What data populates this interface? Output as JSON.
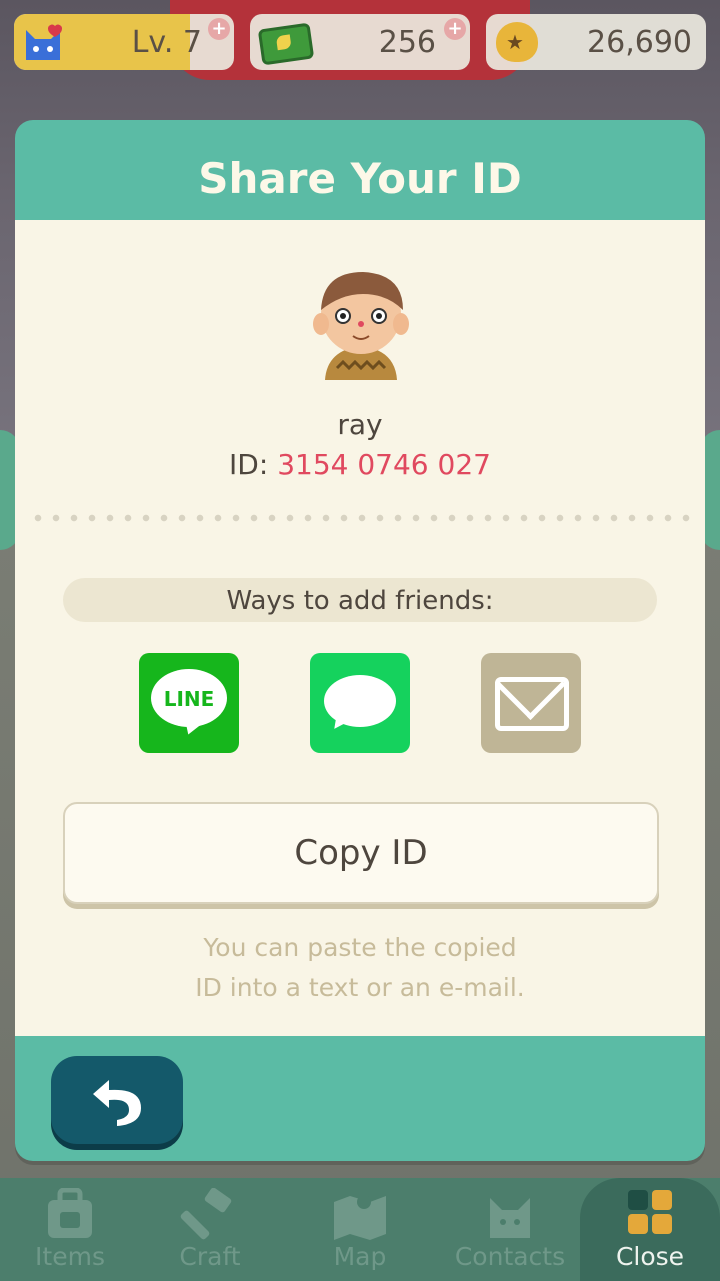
{
  "hud": {
    "level_label": "Lv. 7",
    "level_progress": 0.8,
    "leaf_tickets": "256",
    "bells": "26,690",
    "plus_symbol": "+"
  },
  "dialog": {
    "title": "Share Your ID",
    "player_name": "ray",
    "id_prefix": "ID: ",
    "id_value": "3154 0746 027",
    "ways_label": "Ways to add friends:",
    "share_options": [
      "line-icon",
      "message-icon",
      "mail-icon"
    ],
    "line_text": "LINE",
    "copy_button": "Copy ID",
    "hint_line1": "You can paste the copied",
    "hint_line2": "ID into a text or an e-mail."
  },
  "nav": {
    "items": [
      {
        "label": "Items",
        "icon": "backpack-icon"
      },
      {
        "label": "Craft",
        "icon": "hammer-icon"
      },
      {
        "label": "Map",
        "icon": "map-icon"
      },
      {
        "label": "Contacts",
        "icon": "cat-icon"
      },
      {
        "label": "Close",
        "icon": "grid-icon"
      }
    ]
  },
  "colors": {
    "teal": "#5bbba5",
    "panel": "#f9f5e6",
    "id_red": "#e0495f",
    "line_green": "#16b61c",
    "message_green": "#15d25d",
    "mail_tan": "#bfb596",
    "back_dark": "#14596a"
  }
}
